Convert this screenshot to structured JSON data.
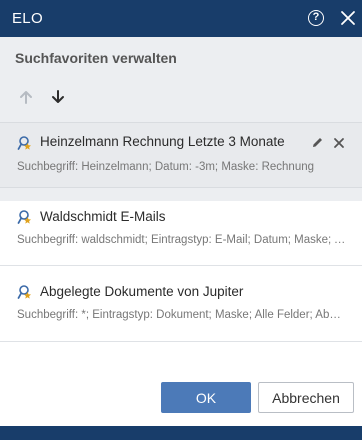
{
  "dialog": {
    "title": "ELO",
    "heading": "Suchfavoriten verwalten"
  },
  "favorites": [
    {
      "name": "Heinzelmann Rechnung Letzte 3 Monate",
      "description": "Suchbegriff: Heinzelmann; Datum: -3m; Maske: Rechnung",
      "selected": true
    },
    {
      "name": "Waldschmidt E-Mails",
      "description": "Suchbegriff: waldschmidt; Eintragstyp: E-Mail; Datum; Maske; Alle Felder",
      "selected": false
    },
    {
      "name": "Abgelegte Dokumente von Jupiter",
      "description": "Suchbegriff: *; Eintragstyp: Dokument; Maske; Alle Felder; Abgelegt von",
      "selected": false
    }
  ],
  "buttons": {
    "ok": "OK",
    "cancel": "Abbrechen"
  },
  "colors": {
    "titlebar": "#183d6a",
    "primary": "#4c7ab8",
    "panel": "#eceef1"
  },
  "icons": {
    "help": "help-icon",
    "close": "close-icon",
    "move_up": "arrow-up-icon",
    "move_down": "arrow-down-icon",
    "favorite": "saved-search-icon",
    "edit": "pencil-icon",
    "delete": "delete-icon"
  }
}
